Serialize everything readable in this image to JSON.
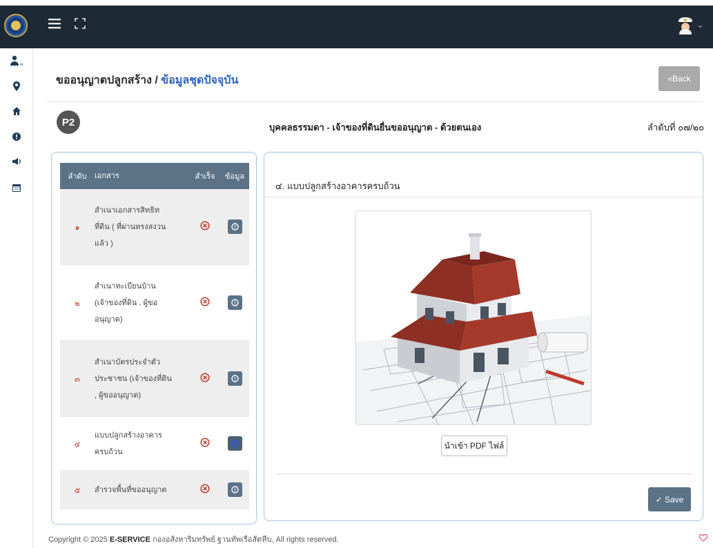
{
  "topbar": {
    "logo_icon": "navy-emblem-icon",
    "menu_icon": "hamburger-menu-icon",
    "fullscreen_icon": "expand-icon",
    "user_icon": "navy-officer-avatar-icon",
    "user_chevron": "⌄"
  },
  "sidebar": {
    "items": [
      {
        "icon": "user-group-icon",
        "glyph": "⛊",
        "label": "…"
      },
      {
        "icon": "map-pin-icon",
        "glyph": "⚲"
      },
      {
        "icon": "home-icon",
        "glyph": "⌂"
      },
      {
        "icon": "info-icon",
        "glyph": "●"
      },
      {
        "icon": "megaphone-icon",
        "glyph": "◀"
      },
      {
        "icon": "calendar-icon",
        "glyph": "▦"
      }
    ]
  },
  "header": {
    "breadcrumb_main": "ขออนุญาตปลูกสร้าง /",
    "breadcrumb_link": "ข้อมูลชุดปัจจุบัน",
    "back_label": "«Back"
  },
  "application": {
    "badge": "P2",
    "person_type": "บุคคลธรรมดา - เจ้าของที่ดินยื่นขออนุญาต - ด้วยตนเอง",
    "sequence": "ลำดับที่ ๐๗/๒๐"
  },
  "documents": {
    "columns": [
      "ลำดับ",
      "เอกสาร",
      "สำเร็จ",
      "ข้อมูล"
    ],
    "rows": [
      {
        "no": "๑",
        "lines": [
          "สำเนาเอกสารสิทธิท",
          "ที่ดิน ( ที่ผ่านทรงสงวน",
          "แล้ว )"
        ]
      },
      {
        "no": "๒",
        "lines": [
          "สำเนาทะเบียนบ้าน",
          "(เจ้าของที่ดิน , ผู้ขอ",
          "อนุญาต)"
        ]
      },
      {
        "no": "๓",
        "lines": [
          "สำเนาบัตรประจำตัว",
          "ประชาชน (เจ้าของที่ดิน",
          ", ผู้ขออนุญาต)"
        ]
      },
      {
        "no": "๔",
        "lines": [
          "แบบปลูกสร้างอาคาร",
          "ครบถ้วน"
        ]
      },
      {
        "no": "๕",
        "lines": [
          "สำรวจพื้นที่ขออนุญาต"
        ]
      }
    ],
    "status_icon": "error-circle-x-icon",
    "info_icon": "info-circle-button-icon"
  },
  "detail": {
    "title": "๔. แบบปลูกสร้างอาคารครบถ้วน",
    "preview_icon": "house-blueprint-image",
    "import_label": "นำเข้า PDF ไฟล์",
    "save_label": "✓ Save"
  },
  "footer": {
    "prefix": "Copyright © 2025 ",
    "brand": "E-SERVICE",
    "suffix": " กองอสังหาริมทรัพย์ ฐานทัพเรือสัตหีบ, All rights reserved.",
    "heart_icon": "heart-icon"
  },
  "colors": {
    "topbar": "#1d2a35",
    "table_header": "#5b7287",
    "link": "#2b62c4",
    "error": "#c0392b",
    "panel_border": "#a9c4dc"
  }
}
